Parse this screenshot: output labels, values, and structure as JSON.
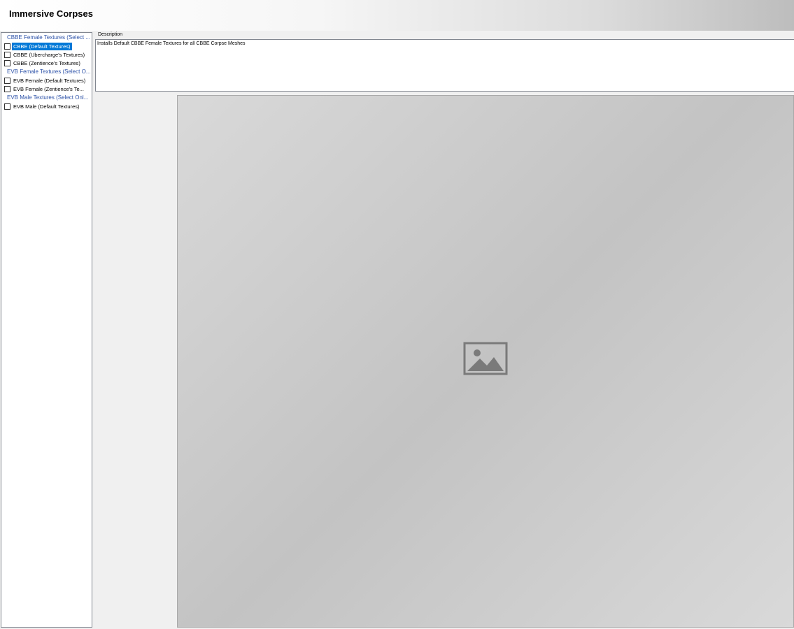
{
  "header": {
    "title": "Immersive Corpses"
  },
  "groups": [
    {
      "label": "CBBE Female Textures (Select ...",
      "options": [
        {
          "label": "CBBE (Default Textures)",
          "checked": false,
          "selected": true
        },
        {
          "label": "CBBE (Ubercharge's Textures)",
          "checked": false,
          "selected": false
        },
        {
          "label": "CBBE (Zentience's Textures)",
          "checked": false,
          "selected": false
        }
      ]
    },
    {
      "label": "EVB Female Textures (Select O...",
      "options": [
        {
          "label": "EVB Female (Default Textures)",
          "checked": false,
          "selected": false
        },
        {
          "label": "EVB Female (Zentience's Te...",
          "checked": false,
          "selected": false
        }
      ]
    },
    {
      "label": "EVB Male Textures (Select Onl...",
      "options": [
        {
          "label": "EVB Male (Default Textures)",
          "checked": false,
          "selected": false
        }
      ]
    }
  ],
  "description": {
    "label": "Description",
    "text": "Installs Default CBBE Female Textures for all CBBE Corpse Meshes"
  },
  "preview": {
    "icon": "image-icon",
    "caption": ""
  }
}
